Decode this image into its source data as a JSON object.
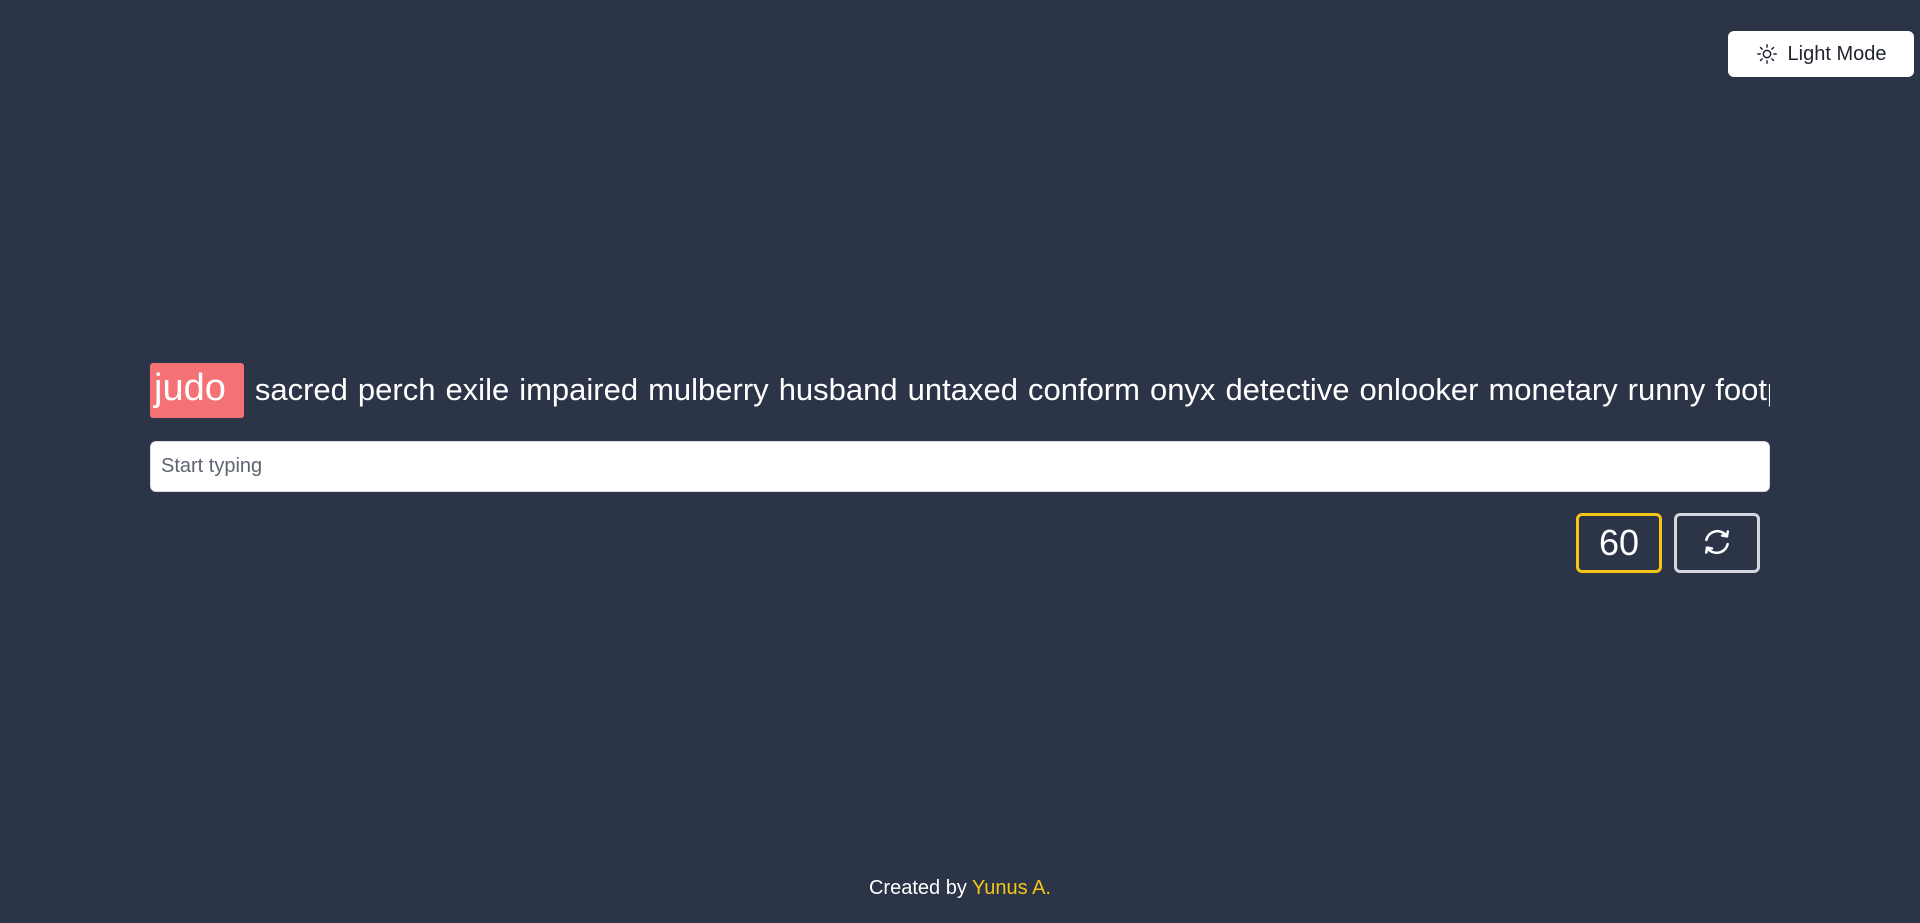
{
  "header": {
    "mode_toggle_label": "Light Mode",
    "mode_toggle_icon": "sun-icon"
  },
  "typing": {
    "current_word": "judo",
    "upcoming_words": [
      "sacred",
      "perch",
      "exile",
      "impaired",
      "mulberry",
      "husband",
      "untaxed",
      "conform",
      "onyx",
      "detective",
      "onlooker",
      "monetary",
      "runny",
      "footpath"
    ],
    "input_value": "",
    "input_placeholder": "Start typing"
  },
  "controls": {
    "timer_value": "60",
    "refresh_icon": "refresh-icon"
  },
  "footer": {
    "prefix": "Created by",
    "author": "Yunus A."
  },
  "colors": {
    "background": "#2c3447",
    "current_word_highlight": "#f47174",
    "accent": "#f5c518"
  }
}
